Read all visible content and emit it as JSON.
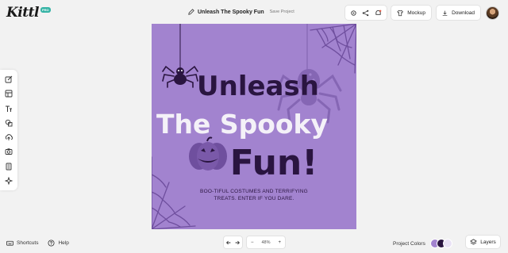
{
  "app": {
    "logo_text": "Kittl",
    "logo_badge": "PRO"
  },
  "header": {
    "project_title": "Unleash The Spooky Fun",
    "save_label": "Save Project",
    "icons": [
      "settings-icon",
      "share-icon",
      "notification-icon"
    ],
    "mockup_label": "Mockup",
    "download_label": "Download"
  },
  "left_toolbar": {
    "tools": [
      "edit-icon",
      "templates-icon",
      "text-icon",
      "elements-icon",
      "upload-icon",
      "photos-icon",
      "layers-panel-icon",
      "ai-magic-icon"
    ]
  },
  "canvas": {
    "background": "#a283cf",
    "headline_line1": "Unleash",
    "headline_line2": "The Spooky",
    "headline_line3": "Fun!",
    "tagline_line1": "BOO-TIFUL COSTUMES AND TERRIFYING",
    "tagline_line2": "TREATS. ENTER IF YOU DARE."
  },
  "footer": {
    "shortcuts_label": "Shortcuts",
    "help_label": "Help",
    "undo_icon": "undo-icon",
    "redo_icon": "redo-icon",
    "zoom_out": "−",
    "zoom_value": "48%",
    "zoom_in": "+",
    "project_colors_label": "Project Colors",
    "project_colors": [
      "#a283cf",
      "#2a1540",
      "#e9e2f5"
    ],
    "layers_label": "Layers"
  },
  "colors": {
    "accent": "#35b3a5",
    "dark_text": "#2a1540",
    "light_text": "#f4f1f8"
  }
}
